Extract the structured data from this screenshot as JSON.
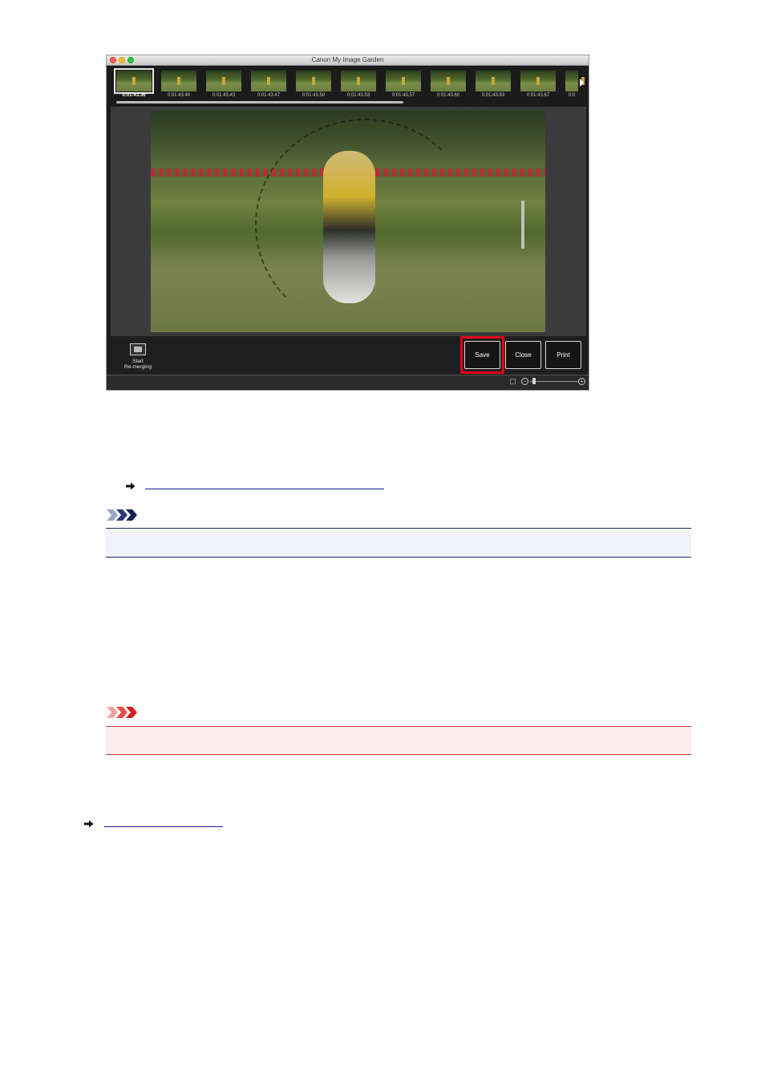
{
  "window": {
    "title": "Canon My Image Garden"
  },
  "filmstrip": {
    "thumbnails": [
      {
        "time": "0:01:43.36"
      },
      {
        "time": "0:01:43.40"
      },
      {
        "time": "0:01:43.43"
      },
      {
        "time": "0:01:43.47"
      },
      {
        "time": "0:01:43.50"
      },
      {
        "time": "0:01:43.53"
      },
      {
        "time": "0:01:43.57"
      },
      {
        "time": "0:01:43.60"
      },
      {
        "time": "0:01:43.63"
      },
      {
        "time": "0:01:43.67"
      },
      {
        "time": "0:0"
      }
    ],
    "selected_index": 0
  },
  "toolbar": {
    "remerge_label": "Start\nRe-merging",
    "save_label": "Save",
    "close_label": "Close",
    "print_label": "Print"
  },
  "colors": {
    "highlight": "#e0001b",
    "note_accent": "#1b2a5e",
    "important_accent": "#e8262f",
    "link": "#1a1a8c"
  },
  "icons": {
    "link_arrow": "right-arrow-icon",
    "note_badge": "note-chevrons-icon",
    "important_badge": "important-chevrons-icon"
  }
}
